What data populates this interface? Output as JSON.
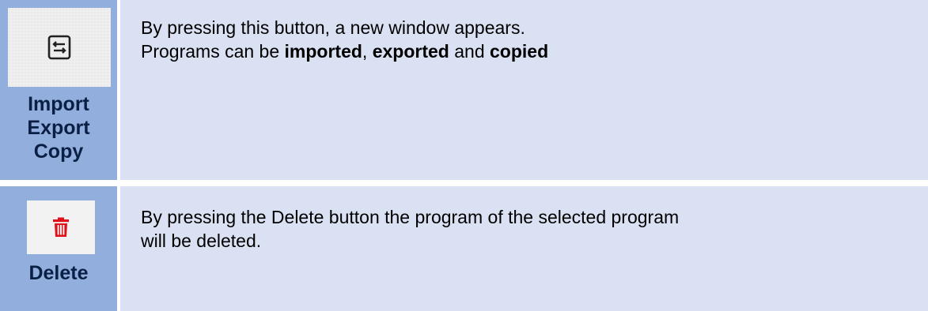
{
  "rows": [
    {
      "icon": "import-export-icon",
      "label_lines": [
        "Import",
        "Export",
        "Copy"
      ],
      "desc_line1": "By pressing this button, a new window appears.",
      "desc_line2_prefix": "Programs can be ",
      "bold_1": "imported",
      "sep_1": ", ",
      "bold_2": "exported",
      "sep_2": " and ",
      "bold_3": "copied"
    },
    {
      "icon": "trash-icon",
      "icon_color": "#e0101a",
      "label": "Delete",
      "desc_line1": "By pressing the Delete button the program of the selected program",
      "desc_line2": "will be deleted."
    }
  ],
  "colors": {
    "label_cell": "#92aedd",
    "desc_cell": "#d9e1f2",
    "label_text": "#0a1f44"
  }
}
